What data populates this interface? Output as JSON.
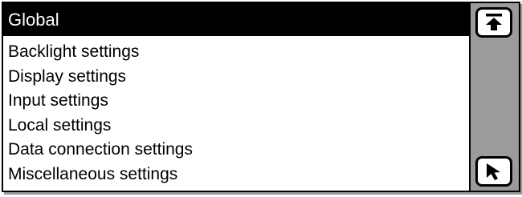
{
  "menu": {
    "title": "Global",
    "items": [
      {
        "label": "Backlight settings"
      },
      {
        "label": "Display settings"
      },
      {
        "label": "Input settings"
      },
      {
        "label": "Local settings"
      },
      {
        "label": "Data connection settings"
      },
      {
        "label": "Miscellaneous settings"
      }
    ]
  },
  "scrollbar": {
    "top_button_icon": "scroll-to-top-icon",
    "bottom_button_icon": "cursor-arrow-icon"
  },
  "colors": {
    "title_background": "#000000",
    "title_text": "#ffffff",
    "rail_background": "#9b9b9b"
  }
}
